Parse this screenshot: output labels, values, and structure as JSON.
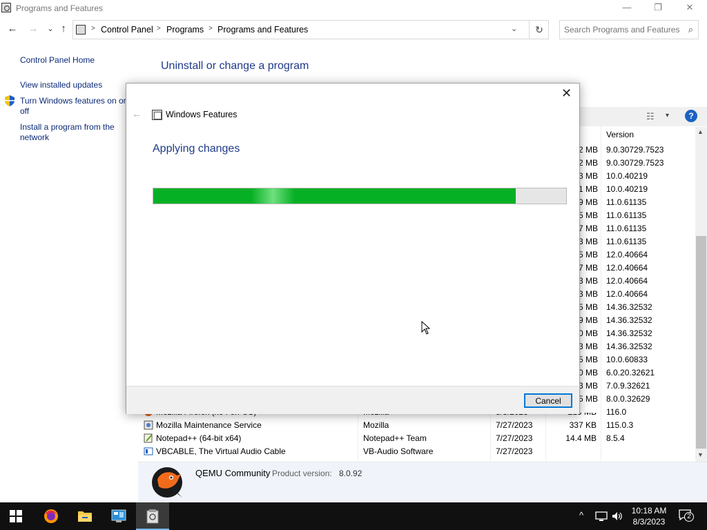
{
  "window": {
    "title": "Programs and Features",
    "minimize": "—",
    "restore": "❐",
    "close": "✕"
  },
  "nav": {
    "back": "←",
    "forward": "→",
    "recent": "⌄",
    "up": "↑",
    "breadcrumb": [
      "Control Panel",
      "Programs",
      "Programs and Features"
    ],
    "separator": ">",
    "dropdown": "⌄",
    "refresh": "↻",
    "search_placeholder": "Search Programs and Features",
    "search_icon": "⌕"
  },
  "sidebar": {
    "home": "Control Panel Home",
    "view_updates": "View installed updates",
    "features_line1": "Turn Windows features on or",
    "features_line2": "off",
    "install_line1": "Install a program from the",
    "install_line2": "network"
  },
  "main": {
    "heading": "Uninstall or change a program",
    "view_icon": "☷",
    "view_dropdown": "▾",
    "help": "?",
    "version_header": "Version"
  },
  "behind_rows": [
    {
      "size": "2 MB",
      "version": "9.0.30729.7523"
    },
    {
      "size": "2 MB",
      "version": "9.0.30729.7523"
    },
    {
      "size": "3 MB",
      "version": "10.0.40219"
    },
    {
      "size": "1 MB",
      "version": "10.0.40219"
    },
    {
      "size": "9 MB",
      "version": "11.0.61135"
    },
    {
      "size": "5 MB",
      "version": "11.0.61135"
    },
    {
      "size": "7 MB",
      "version": "11.0.61135"
    },
    {
      "size": "3 MB",
      "version": "11.0.61135"
    },
    {
      "size": "5 MB",
      "version": "12.0.40664"
    },
    {
      "size": "7 MB",
      "version": "12.0.40664"
    },
    {
      "size": "3 MB",
      "version": "12.0.40664"
    },
    {
      "size": "3 MB",
      "version": "12.0.40664"
    },
    {
      "size": "5 MB",
      "version": "14.36.32532"
    },
    {
      "size": "9 MB",
      "version": "14.36.32532"
    },
    {
      "size": "0 MB",
      "version": "14.36.32532"
    },
    {
      "size": "3 MB",
      "version": "14.36.32532"
    },
    {
      "size": "5 MB",
      "version": "10.0.60833"
    },
    {
      "size": "0 MB",
      "version": "6.0.20.32621"
    },
    {
      "size": "3 MB",
      "version": "7.0.9.32621"
    },
    {
      "size": "5 MB",
      "version": "8.0.0.32629"
    }
  ],
  "visible_rows": [
    {
      "name": "Mozilla Firefox (x64 en-US)",
      "publisher": "Mozilla",
      "installed": "8/3/2023",
      "size": "219 MB",
      "version": "116.0"
    },
    {
      "name": "Mozilla Maintenance Service",
      "publisher": "Mozilla",
      "installed": "7/27/2023",
      "size": "337 KB",
      "version": "115.0.3"
    },
    {
      "name": "Notepad++ (64-bit x64)",
      "publisher": "Notepad++ Team",
      "installed": "7/27/2023",
      "size": "14.4 MB",
      "version": "8.5.4"
    },
    {
      "name": "VBCABLE, The Virtual Audio Cable",
      "publisher": "VB-Audio Software",
      "installed": "7/27/2023",
      "size": "",
      "version": ""
    }
  ],
  "details": {
    "name": "QEMU Community",
    "label": "Product version:",
    "version": "8.0.92"
  },
  "dialog": {
    "close": "✕",
    "back": "←",
    "title": "Windows Features",
    "status": "Applying changes",
    "progress_fraction": 0.878,
    "cancel": "Cancel"
  },
  "taskbar": {
    "time": "10:18 AM",
    "date": "8/3/2023",
    "chevron": "^",
    "notifications": "2"
  }
}
